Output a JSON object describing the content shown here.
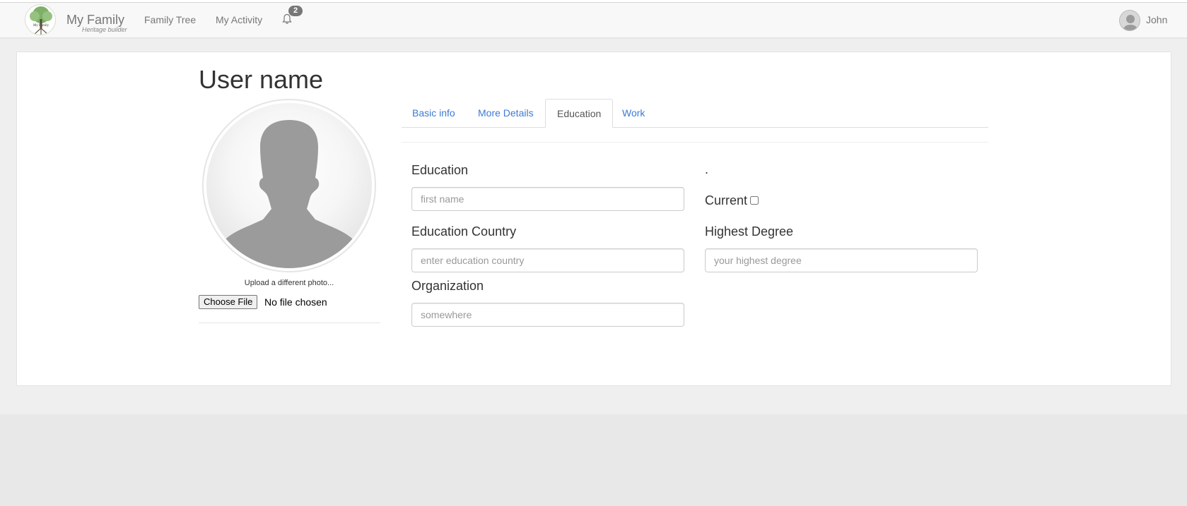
{
  "navbar": {
    "brand": "My Family",
    "tagline": "Heritage builder",
    "links": [
      "Family Tree",
      "My Activity"
    ],
    "notification_count": "2",
    "user": "John",
    "logo_text": "My Family"
  },
  "profile": {
    "title": "User name",
    "upload_label": "Upload a different photo...",
    "choose_file": "Choose File",
    "file_status": "No file chosen"
  },
  "tabs": [
    {
      "label": "Basic info",
      "active": false
    },
    {
      "label": "More Details",
      "active": false
    },
    {
      "label": "Education",
      "active": true
    },
    {
      "label": "Work",
      "active": false
    }
  ],
  "form": {
    "education": {
      "label": "Education",
      "placeholder": "first name",
      "value": ""
    },
    "dot": ".",
    "current": {
      "label": "Current",
      "checked": false
    },
    "education_country": {
      "label": "Education Country",
      "placeholder": "enter education country",
      "value": ""
    },
    "highest_degree": {
      "label": "Highest Degree",
      "placeholder": "your highest degree",
      "value": ""
    },
    "organization": {
      "label": "Organization",
      "placeholder": "somewhere",
      "value": ""
    }
  },
  "colors": {
    "link": "#3b7bd4",
    "navbar_bg": "#f8f8f8",
    "page_bg": "#efefef",
    "silhouette": "#9b9b9b"
  }
}
